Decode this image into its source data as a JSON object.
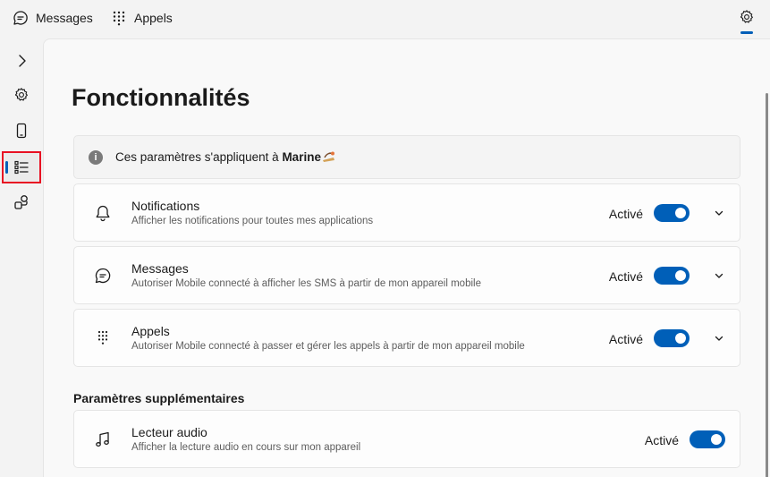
{
  "topbar": {
    "tabs": [
      {
        "label": "Messages",
        "icon": "chat-bubble-icon"
      },
      {
        "label": "Appels",
        "icon": "dialpad-icon"
      }
    ],
    "settings_icon": "gear-icon",
    "accent": "#005fb8"
  },
  "sidebar": {
    "items": [
      {
        "icon": "chevron-right-icon",
        "name": "expand"
      },
      {
        "icon": "gear-icon",
        "name": "settings"
      },
      {
        "icon": "phone-icon",
        "name": "mobile-device"
      },
      {
        "icon": "list-icon",
        "name": "features",
        "selected": true
      },
      {
        "icon": "devices-icon",
        "name": "devices"
      }
    ]
  },
  "main": {
    "title": "Fonctionnalités",
    "info": {
      "prefix": "Ces paramètres s'appliquent à ",
      "name": "Marine"
    },
    "features": [
      {
        "title": "Notifications",
        "description": "Afficher les notifications pour toutes mes applications",
        "status": "Activé",
        "enabled": true,
        "icon": "bell-icon"
      },
      {
        "title": "Messages",
        "description": "Autoriser Mobile connecté à afficher les SMS à partir de mon appareil mobile",
        "status": "Activé",
        "enabled": true,
        "icon": "chat-bubble-icon"
      },
      {
        "title": "Appels",
        "description": "Autoriser Mobile connecté à passer et gérer les appels à partir de mon appareil mobile",
        "status": "Activé",
        "enabled": true,
        "icon": "dialpad-icon"
      }
    ],
    "additional": {
      "section_title": "Paramètres supplémentaires",
      "items": [
        {
          "title": "Lecteur audio",
          "description": "Afficher la lecture audio en cours sur mon appareil",
          "status": "Activé",
          "enabled": true,
          "icon": "music-note-icon"
        }
      ]
    }
  }
}
